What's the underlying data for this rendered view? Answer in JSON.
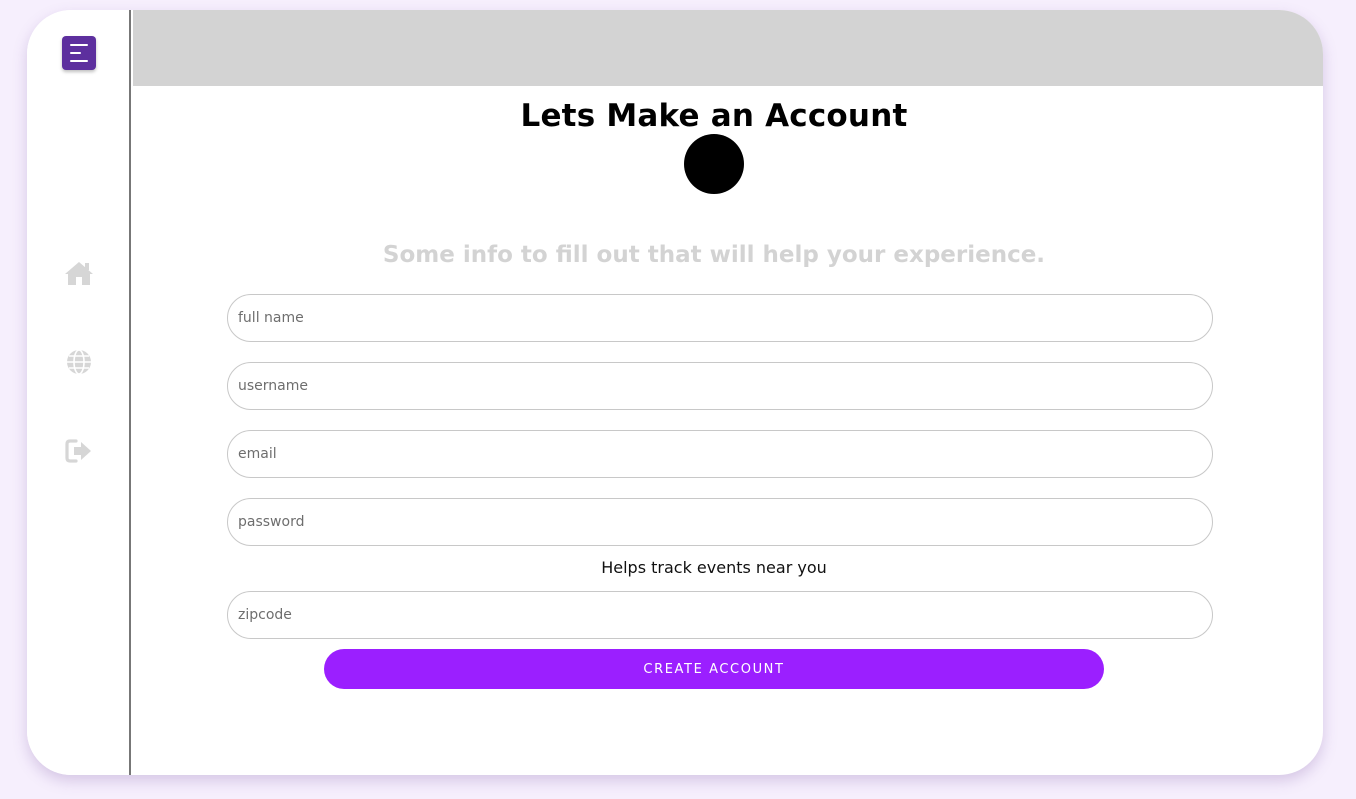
{
  "colors": {
    "page_background": "#f6effd",
    "menu_button": "#5d2f9e",
    "topbar": "#d3d3d3",
    "accent_button": "#9b1fff",
    "nav_icon": "#d6d6d6",
    "subtitle": "#d3d3d3"
  },
  "sidebar": {
    "menu_icon": "menu-icon",
    "items": [
      {
        "name": "home",
        "icon": "home-icon"
      },
      {
        "name": "globe",
        "icon": "globe-icon"
      },
      {
        "name": "logout",
        "icon": "logout-icon"
      }
    ]
  },
  "form": {
    "title": "Lets Make an Account",
    "subtitle": "Some info to fill out that will help your experience.",
    "fields": {
      "full_name": {
        "placeholder": "full name",
        "value": ""
      },
      "username": {
        "placeholder": "username",
        "value": ""
      },
      "email": {
        "placeholder": "email",
        "value": ""
      },
      "password": {
        "placeholder": "password",
        "value": ""
      },
      "zipcode": {
        "placeholder": "zipcode",
        "value": ""
      }
    },
    "zipcode_helper": "Helps track events near you",
    "submit_label": "Create Account"
  }
}
